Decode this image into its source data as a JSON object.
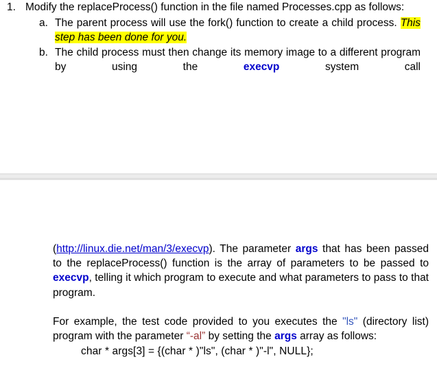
{
  "document": {
    "list": {
      "item1": {
        "marker": "1.",
        "lead_text": "Modify the replaceProcess() function in the file named Processes.cpp as follows:",
        "subitems": [
          {
            "marker": "a.",
            "text_before": "The parent process will use the fork() function to create a child process. ",
            "highlight": "This step has been done for you."
          },
          {
            "marker": "b.",
            "text_before": "The child process must then change its memory image to a different program by using the ",
            "keyword": "execvp",
            "text_after": " system call"
          }
        ]
      }
    },
    "separator": {
      "name": "page-break-separator"
    },
    "bottom": {
      "paragraph1": {
        "open_paren": "(",
        "link_text": "http://linux.die.net/man/3/execvp",
        "after_link": "). The parameter ",
        "kw_args_1": "args",
        "mid_1": " that has been passed to the replaceProcess() function is the array of parameters to be passed to ",
        "kw_execvp": "execvp",
        "mid_2": ", telling it which program to execute and what parameters to pass to that program."
      },
      "paragraph2": {
        "text_1": "For example, the test code provided to you executes the ",
        "str_ls": "\"ls\"",
        "text_2": " (directory list) program with the parameter ",
        "str_al": "“-al”",
        "text_3": " by setting the ",
        "kw_args_2": "args",
        "text_4": " array as follows:"
      },
      "code": "char * args[3] = {(char * )\"ls\", (char * )\"-l\", NULL};"
    }
  },
  "colors": {
    "highlight": "#FFFF00",
    "keyword_blue": "#0000CC",
    "link_blue": "#0000CC",
    "string_blue": "#3355BB",
    "string_red": "#993333",
    "text": "#000000",
    "separator_gray": "#d8d8d8",
    "background": "#FFFFFF"
  }
}
